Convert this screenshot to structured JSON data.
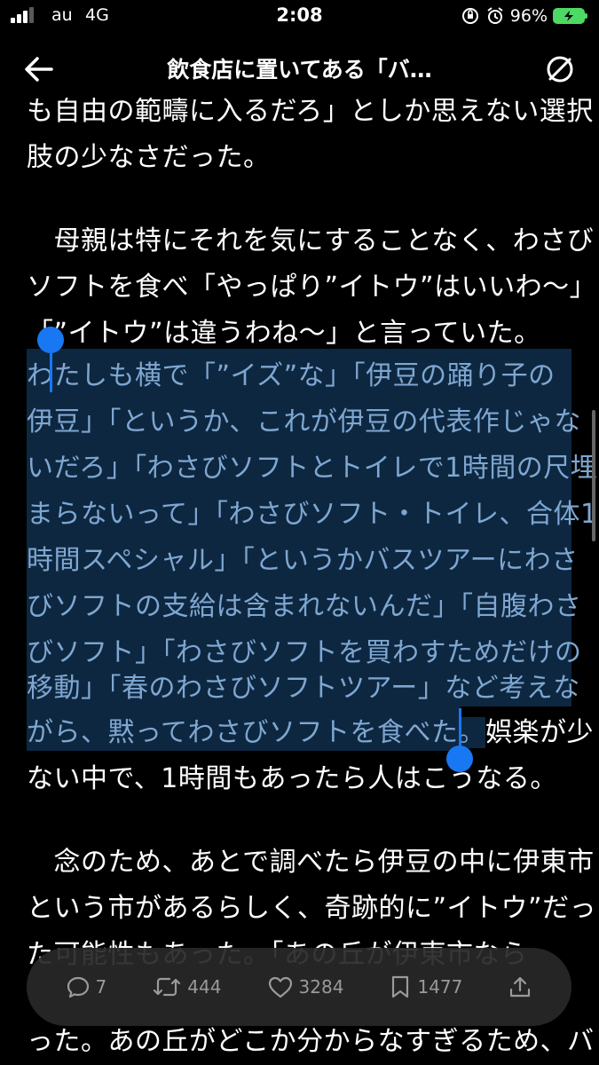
{
  "status_bar": {
    "carrier": "au",
    "network": "4G",
    "time": "2:08",
    "battery_percent": "96%",
    "battery_level": 0.96,
    "battery_color": "#4cd964"
  },
  "header": {
    "title": "飲食店に置いてある「バ…",
    "back_icon": "arrow-left-icon",
    "reader_icon": "no-sign-icon"
  },
  "article": {
    "lines": [
      "も自由の範疇に入るだろ」としか思えない選択",
      "肢の少なさだった。",
      "",
      "　母親は特にそれを気にすることなく、わさび",
      "ソフトを食べ「やっぱり”イトウ”はいいわ〜」",
      "「”イトウ”は違うわね〜」と言っていた。",
      "わたしも横で「”イズ”な」「伊豆の踊り子の",
      "伊豆」「というか、これが伊豆の代表作じゃな",
      "いだろ」「わさびソフトとトイレで1時間の尺埋",
      "まらないって」「わさびソフト・トイレ、合体1",
      "時間スペシャル」「というかバスツアーにわさ",
      "びソフトの支給は含まれないんだ」「自腹わさ",
      "びソフト」「わさびソフトを買わすためだけの",
      "移動」「春のわさびソフトツアー」など考えな",
      "がら、黙ってわさびソフトを食べた。",
      "娯楽が少",
      "ない中で、1時間もあったら人はこうなる。",
      "",
      "　念のため、あとで調べたら伊豆の中に伊東市",
      "という市があるらしく、奇跡的に”イトウ”だっ",
      "た可能性もあった。「あの丘が伊東市なら",
      "った。あの丘がどこか分からなすぎるため、バ"
    ],
    "selection_color": "#0e2740",
    "selection_text_color": "#7ea7d1",
    "handle_color": "#1877f2"
  },
  "actions": {
    "reply_count": "7",
    "retweet_count": "444",
    "like_count": "3284",
    "bookmark_count": "1477",
    "reply_icon": "speech-bubble-icon",
    "retweet_icon": "retweet-icon",
    "like_icon": "heart-icon",
    "bookmark_icon": "bookmark-icon",
    "share_icon": "share-icon"
  }
}
